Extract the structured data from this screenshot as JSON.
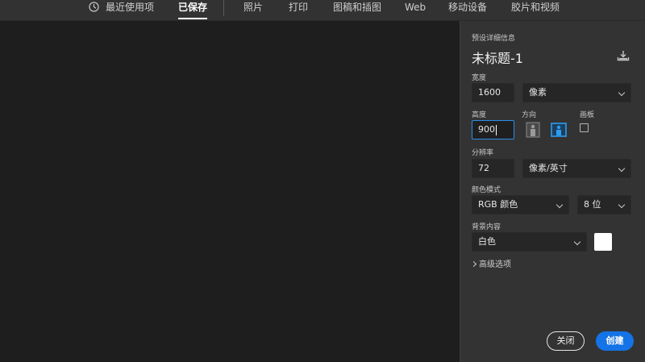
{
  "tabs": [
    {
      "label": "最近使用项",
      "icon": "clock-icon",
      "active": false
    },
    {
      "label": "已保存",
      "active": true
    },
    {
      "label": "照片",
      "active": false
    },
    {
      "label": "打印",
      "active": false
    },
    {
      "label": "图稿和插图",
      "active": false
    },
    {
      "label": "Web",
      "active": false
    },
    {
      "label": "移动设备",
      "active": false
    },
    {
      "label": "胶片和视频",
      "active": false
    }
  ],
  "panel": {
    "heading": "预设详细信息",
    "doc_name": "未标题-1",
    "width_label": "宽度",
    "width_value": "1600",
    "width_unit": "像素",
    "height_label": "高度",
    "height_value": "900",
    "orientation_label": "方向",
    "artboard_label": "画板",
    "resolution_label": "分辨率",
    "resolution_value": "72",
    "resolution_unit": "像素/英寸",
    "color_mode_label": "颜色模式",
    "color_mode_value": "RGB 颜色",
    "bit_depth_value": "8 位",
    "background_label": "背景内容",
    "background_value": "白色",
    "background_swatch_color": "#ffffff",
    "advanced_label": "高级选项",
    "close_button": "关闭",
    "create_button": "创建"
  },
  "colors": {
    "accent": "#1473e6",
    "focus_border": "#2d8ceb",
    "orientation_active": "#2d9cf0"
  }
}
